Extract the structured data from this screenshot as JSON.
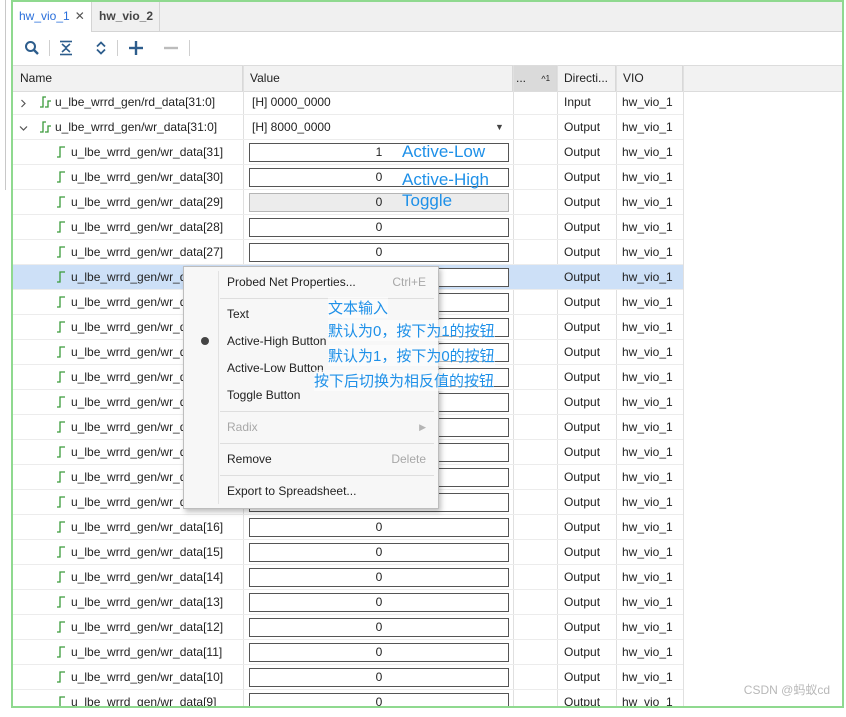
{
  "tabs": [
    {
      "label": "hw_vio_1",
      "active": true,
      "closable": true
    },
    {
      "label": "hw_vio_2",
      "active": false,
      "closable": false
    }
  ],
  "toolbar": {
    "icons": [
      "search-icon",
      "collapse-all-icon",
      "expand-all-icon",
      "add-icon",
      "remove-icon"
    ]
  },
  "columns": {
    "name": "Name",
    "value": "Value",
    "activity": "...",
    "activity_sort": "1",
    "direction": "Directi...",
    "vio": "VIO"
  },
  "rows": [
    {
      "name": "u_lbe_wrrd_gen/rd_data[31:0]",
      "value": "[H] 0000_0000",
      "direction": "Input",
      "vio": "hw_vio_1",
      "kind": "bus",
      "expanded": false
    },
    {
      "name": "u_lbe_wrrd_gen/wr_data[31:0]",
      "value": "[H] 8000_0000",
      "direction": "Output",
      "vio": "hw_vio_1",
      "kind": "bus",
      "expanded": true
    },
    {
      "name": "u_lbe_wrrd_gen/wr_data[31]",
      "value": "1",
      "direction": "Output",
      "vio": "hw_vio_1",
      "kind": "box"
    },
    {
      "name": "u_lbe_wrrd_gen/wr_data[30]",
      "value": "0",
      "direction": "Output",
      "vio": "hw_vio_1",
      "kind": "box"
    },
    {
      "name": "u_lbe_wrrd_gen/wr_data[29]",
      "value": "0",
      "direction": "Output",
      "vio": "hw_vio_1",
      "kind": "toggle"
    },
    {
      "name": "u_lbe_wrrd_gen/wr_data[28]",
      "value": "0",
      "direction": "Output",
      "vio": "hw_vio_1",
      "kind": "box"
    },
    {
      "name": "u_lbe_wrrd_gen/wr_data[27]",
      "value": "0",
      "direction": "Output",
      "vio": "hw_vio_1",
      "kind": "box"
    },
    {
      "name": "u_lbe_wrrd_gen/wr_data[26]",
      "value": "",
      "direction": "Output",
      "vio": "hw_vio_1",
      "kind": "box",
      "selected": true
    },
    {
      "name": "u_lbe_wrrd_gen/wr_data[25]",
      "value": "",
      "direction": "Output",
      "vio": "hw_vio_1",
      "kind": "box"
    },
    {
      "name": "u_lbe_wrrd_gen/wr_data[24]",
      "value": "",
      "direction": "Output",
      "vio": "hw_vio_1",
      "kind": "box"
    },
    {
      "name": "u_lbe_wrrd_gen/wr_data[23]",
      "value": "",
      "direction": "Output",
      "vio": "hw_vio_1",
      "kind": "box"
    },
    {
      "name": "u_lbe_wrrd_gen/wr_data[22]",
      "value": "",
      "direction": "Output",
      "vio": "hw_vio_1",
      "kind": "box"
    },
    {
      "name": "u_lbe_wrrd_gen/wr_data[21]",
      "value": "",
      "direction": "Output",
      "vio": "hw_vio_1",
      "kind": "box"
    },
    {
      "name": "u_lbe_wrrd_gen/wr_data[20]",
      "value": "",
      "direction": "Output",
      "vio": "hw_vio_1",
      "kind": "box"
    },
    {
      "name": "u_lbe_wrrd_gen/wr_data[19]",
      "value": "",
      "direction": "Output",
      "vio": "hw_vio_1",
      "kind": "box"
    },
    {
      "name": "u_lbe_wrrd_gen/wr_data[18]",
      "value": "",
      "direction": "Output",
      "vio": "hw_vio_1",
      "kind": "box"
    },
    {
      "name": "u_lbe_wrrd_gen/wr_data[17]",
      "value": "",
      "direction": "Output",
      "vio": "hw_vio_1",
      "kind": "box"
    },
    {
      "name": "u_lbe_wrrd_gen/wr_data[16]",
      "value": "0",
      "direction": "Output",
      "vio": "hw_vio_1",
      "kind": "box"
    },
    {
      "name": "u_lbe_wrrd_gen/wr_data[15]",
      "value": "0",
      "direction": "Output",
      "vio": "hw_vio_1",
      "kind": "box"
    },
    {
      "name": "u_lbe_wrrd_gen/wr_data[14]",
      "value": "0",
      "direction": "Output",
      "vio": "hw_vio_1",
      "kind": "box"
    },
    {
      "name": "u_lbe_wrrd_gen/wr_data[13]",
      "value": "0",
      "direction": "Output",
      "vio": "hw_vio_1",
      "kind": "box"
    },
    {
      "name": "u_lbe_wrrd_gen/wr_data[12]",
      "value": "0",
      "direction": "Output",
      "vio": "hw_vio_1",
      "kind": "box"
    },
    {
      "name": "u_lbe_wrrd_gen/wr_data[11]",
      "value": "0",
      "direction": "Output",
      "vio": "hw_vio_1",
      "kind": "box"
    },
    {
      "name": "u_lbe_wrrd_gen/wr_data[10]",
      "value": "0",
      "direction": "Output",
      "vio": "hw_vio_1",
      "kind": "box"
    },
    {
      "name": "u_lbe_wrrd_gen/wr_data[9]",
      "value": "0",
      "direction": "Output",
      "vio": "hw_vio_1",
      "kind": "box"
    }
  ],
  "annotations": {
    "active_low": "Active-Low",
    "active_high": "Active-High",
    "toggle": "Toggle",
    "text_input": "文本输入",
    "active_high_desc": "默认为0，按下为1的按钮",
    "active_low_desc": "默认为1，按下为0的按钮",
    "toggle_desc": "按下后切换为相反值的按钮"
  },
  "context_menu": {
    "items": [
      {
        "label": "Probed Net Properties...",
        "shortcut": "Ctrl+E",
        "enabled": true
      },
      {
        "label": "Text",
        "enabled": true
      },
      {
        "label": "Active-High Button",
        "enabled": true,
        "checked": true
      },
      {
        "label": "Active-Low Button",
        "enabled": true
      },
      {
        "label": "Toggle Button",
        "enabled": true
      },
      {
        "label": "Radix",
        "enabled": false,
        "submenu": true
      },
      {
        "label": "Remove",
        "shortcut": "Delete",
        "enabled": true
      },
      {
        "label": "Export to Spreadsheet...",
        "enabled": true
      }
    ]
  },
  "watermark": "CSDN @蚂蚁cd",
  "colors": {
    "accent": "#2a6fdb",
    "annotation": "#1e90e8",
    "selection": "#cde0f7",
    "frame": "#8fd98f"
  }
}
